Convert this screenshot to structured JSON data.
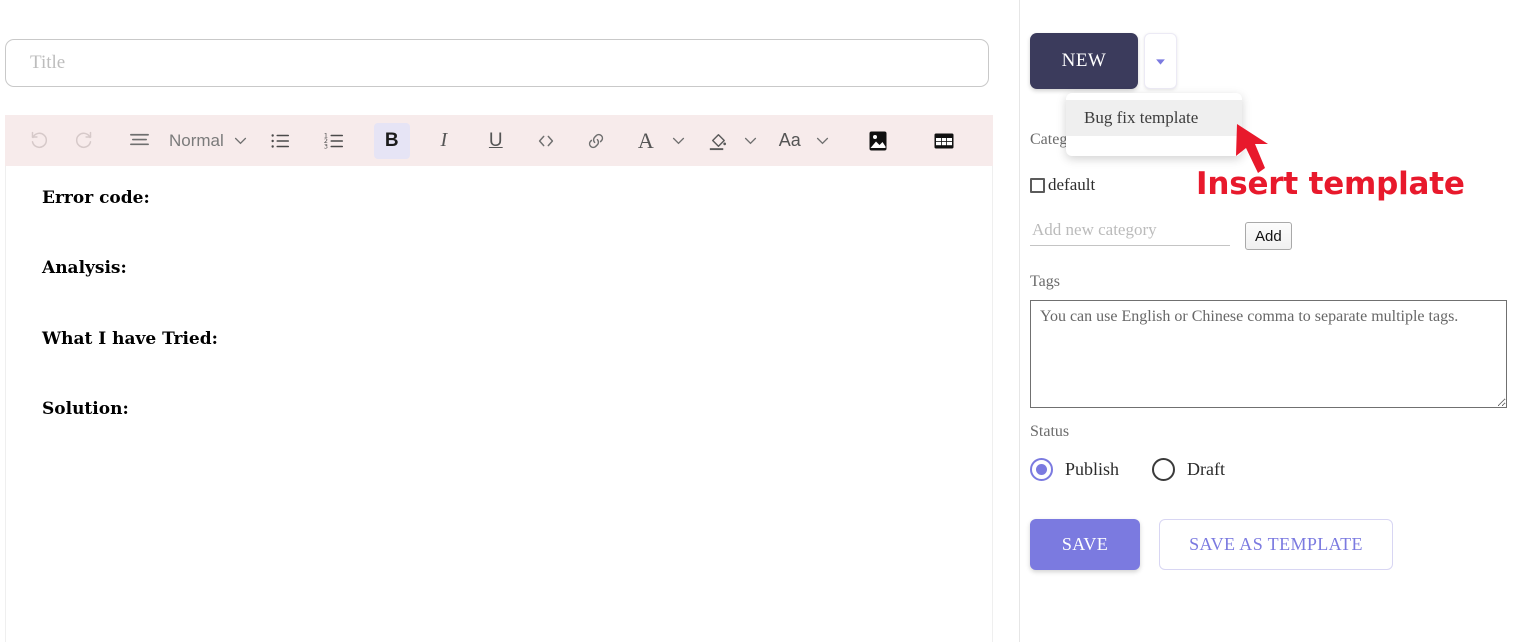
{
  "editor": {
    "title_placeholder": "Title",
    "toolbar": {
      "undo_label": "undo",
      "redo_label": "redo",
      "block_format": "Normal",
      "bullet_list_label": "bullet-list",
      "ordered_list_label": "ordered-list",
      "bold_label": "B",
      "italic_label": "I",
      "underline_label": "U",
      "code_label": "<>",
      "link_label": "link",
      "font_color_label": "A",
      "highlight_label": "highlight",
      "font_size_label": "Aa",
      "image_label": "image",
      "table_label": "table"
    },
    "content_lines": [
      "Error code:",
      "Analysis:",
      "What I have Tried:",
      "Solution:"
    ]
  },
  "side": {
    "new_button": "NEW",
    "template_menu": {
      "items": [
        "Bug fix template"
      ]
    },
    "categories_label": "Categories",
    "category_items": [
      {
        "name": "default",
        "checked": false
      }
    ],
    "add_category_placeholder": "Add new category",
    "add_button": "Add",
    "tags_label": "Tags",
    "tags_placeholder": "You can use English or Chinese comma to separate multiple tags.",
    "status_label": "Status",
    "status_options": [
      {
        "label": "Publish",
        "selected": true
      },
      {
        "label": "Draft",
        "selected": false
      }
    ],
    "save_button": "SAVE",
    "save_template_button": "SAVE AS TEMPLATE"
  },
  "annotation": {
    "text": "Insert template",
    "color": "#e8192c"
  },
  "colors": {
    "accent": "#7b7ae0",
    "new_button_bg": "#3b3b5c",
    "toolbar_bg": "#f7ebeb",
    "annotation_red": "#e8192c"
  }
}
